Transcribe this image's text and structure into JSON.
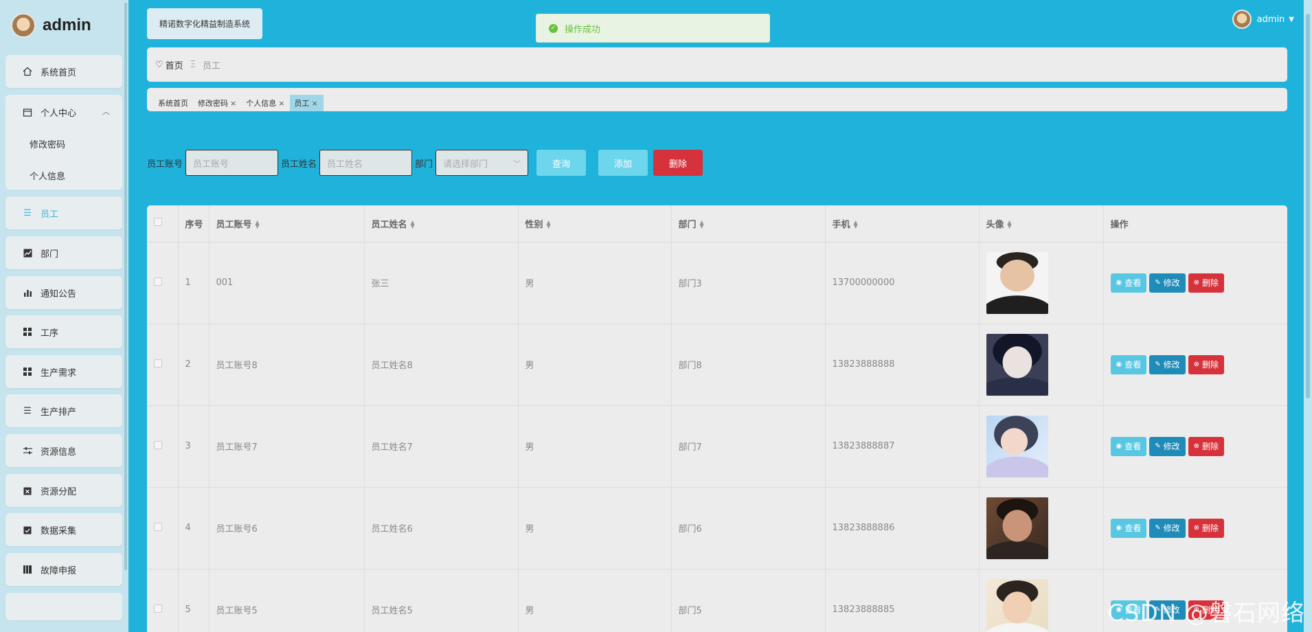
{
  "brand": {
    "title": "admin"
  },
  "sidebar": {
    "home": "系统首页",
    "personal_center": "个人中心",
    "personal_sub": [
      "修改密码",
      "个人信息"
    ],
    "items": [
      {
        "label": "员工",
        "icon": "list-icon"
      },
      {
        "label": "部门",
        "icon": "chart-line-icon"
      },
      {
        "label": "通知公告",
        "icon": "bar-chart-icon"
      },
      {
        "label": "工序",
        "icon": "grid-icon"
      },
      {
        "label": "生产需求",
        "icon": "grid-icon"
      },
      {
        "label": "生产排产",
        "icon": "list-icon"
      },
      {
        "label": "资源信息",
        "icon": "sliders-icon"
      },
      {
        "label": "资源分配",
        "icon": "clipboard-x-icon"
      },
      {
        "label": "数据采集",
        "icon": "clipboard-check-icon"
      },
      {
        "label": "故障申报",
        "icon": "book-icon"
      }
    ]
  },
  "header": {
    "system_title": "精诺数字化精益制造系统",
    "toast": "操作成功",
    "user": "admin"
  },
  "breadcrumb": {
    "home": "首页",
    "current": "员工"
  },
  "tabs": [
    {
      "label": "系统首页",
      "closable": false,
      "active": false
    },
    {
      "label": "修改密码",
      "closable": true,
      "active": false
    },
    {
      "label": "个人信息",
      "closable": true,
      "active": false
    },
    {
      "label": "员工",
      "closable": true,
      "active": true
    }
  ],
  "search": {
    "account_label": "员工账号",
    "account_placeholder": "员工账号",
    "name_label": "员工姓名",
    "name_placeholder": "员工姓名",
    "dept_label": "部门",
    "dept_placeholder": "请选择部门",
    "query_btn": "查询",
    "add_btn": "添加",
    "delete_btn": "删除"
  },
  "table": {
    "headers": [
      "序号",
      "员工账号",
      "员工姓名",
      "性别",
      "部门",
      "手机",
      "头像",
      "操作"
    ],
    "actions": {
      "view": "查看",
      "edit": "修改",
      "delete": "删除"
    },
    "rows": [
      {
        "no": "1",
        "account": "001",
        "name": "张三",
        "gender": "男",
        "dept": "部门3",
        "phone": "13700000000"
      },
      {
        "no": "2",
        "account": "员工账号8",
        "name": "员工姓名8",
        "gender": "男",
        "dept": "部门8",
        "phone": "13823888888"
      },
      {
        "no": "3",
        "account": "员工账号7",
        "name": "员工姓名7",
        "gender": "男",
        "dept": "部门7",
        "phone": "13823888887"
      },
      {
        "no": "4",
        "account": "员工账号6",
        "name": "员工姓名6",
        "gender": "男",
        "dept": "部门6",
        "phone": "13823888886"
      },
      {
        "no": "5",
        "account": "员工账号5",
        "name": "员工姓名5",
        "gender": "男",
        "dept": "部门5",
        "phone": "13823888885"
      }
    ]
  },
  "watermark": "CSDN @磐石网络",
  "colors": {
    "primary": "#1fb3db",
    "danger": "#d6323c",
    "success": "#67c23a",
    "edit": "#1f8bb8"
  }
}
